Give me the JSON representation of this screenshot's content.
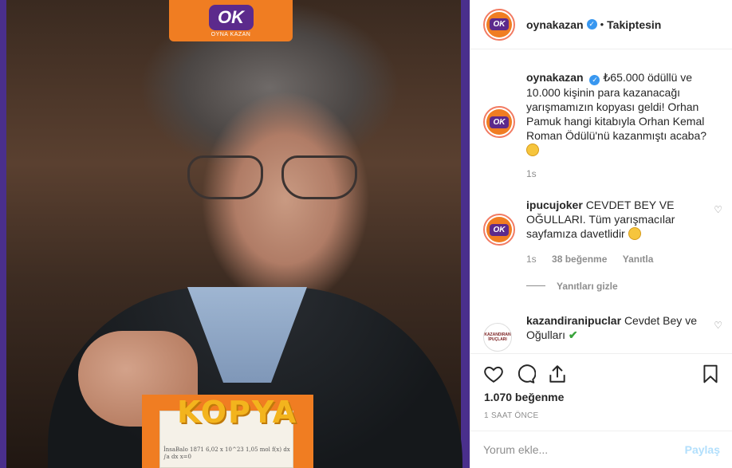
{
  "post_image": {
    "logo_text": "OK",
    "logo_sub": "OYNA KAZAN",
    "kopya_title": "KOPYA",
    "kopya_notes": "İnsaBalo 1871   6,02 x 10^23   1,05 mol   f(x) dx   ∫a dx   x=0",
    "note_num": "x=0"
  },
  "header": {
    "username": "oynakazan",
    "verified_icon": "verified-badge-icon",
    "separator": "•",
    "follow_state": "Takiptesin"
  },
  "caption": {
    "username": "oynakazan",
    "text": "₺65.000 ödüllü ve 10.000 kişinin para kazanacağı yarışmamızın kopyası geldi! Orhan Pamuk hangi kitabıyla Orhan Kemal Roman Ödülü'nü kazanmıştı acaba?",
    "time": "1s"
  },
  "comments": [
    {
      "username": "ipucujoker",
      "text": "CEVDET BEY VE OĞULLARI. Tüm yarışmacılar sayfamıza davetlidir",
      "time": "1s",
      "likes": "38 beğenme",
      "reply": "Yanıtla"
    },
    {
      "username": "kazandiranipuclar",
      "text": "Cevdet Bey ve Oğulları",
      "avatar_text": "KAZANDIRAN İPUÇLARI"
    }
  ],
  "hide_replies": "Yanıtları gizle",
  "actions": {
    "like_icon": "heart-icon",
    "comment_icon": "comment-icon",
    "share_icon": "share-icon",
    "save_icon": "bookmark-icon"
  },
  "likes_count": "1.070 beğenme",
  "post_time": "1 SAAT ÖNCE",
  "add_comment": {
    "placeholder": "Yorum ekle...",
    "post_label": "Paylaş"
  },
  "colors": {
    "brand_orange": "#f07d22",
    "brand_purple": "#5c2a8c",
    "verified_blue": "#3897f0",
    "muted_text": "#8e8e8e"
  }
}
